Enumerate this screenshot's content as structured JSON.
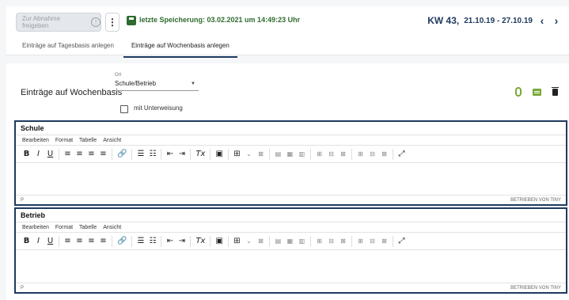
{
  "header": {
    "release_button": "Zur Abnahme freigeben",
    "release_info_icon": "!",
    "more_icon": "⋮",
    "save_status": "letzte Speicherung: 03.02.2021 um 14:49:23 Uhr",
    "week_label": "KW 43,",
    "week_range": "21.10.19 - 27.10.19",
    "prev_icon": "‹",
    "next_icon": "›"
  },
  "tabs": [
    {
      "label": "Einträge auf Tagesbasis anlegen",
      "active": false
    },
    {
      "label": "Einträge auf Wochenbasis anlegen",
      "active": true
    }
  ],
  "form": {
    "title": "Einträge auf Wochenbasis",
    "ort_label": "Ort",
    "ort_value": "Schule/Betrieb",
    "checkbox_label": "mit Unterweisung",
    "accent_color": "#7aa83a"
  },
  "editors": [
    {
      "title": "Schule",
      "menus": [
        "Bearbeiten",
        "Format",
        "Tabelle",
        "Ansicht"
      ],
      "path": "P",
      "powered": "BETRIEBEN VON TINY"
    },
    {
      "title": "Betrieb",
      "menus": [
        "Bearbeiten",
        "Format",
        "Tabelle",
        "Ansicht"
      ],
      "path": "P",
      "powered": "BETRIEBEN VON TINY"
    }
  ],
  "toolbar": {
    "bold": "B",
    "italic": "I",
    "underline": "U",
    "align_left": "≡",
    "align_center": "≡",
    "align_right": "≡",
    "justify": "≡",
    "link": "🔗",
    "bullets": "☰",
    "numbers": "☷",
    "outdent": "⇤",
    "indent": "⇥",
    "clear": "Tx",
    "image": "▣",
    "table": "⊞",
    "table_caret": "⌄",
    "table_delete": "⊠",
    "t1": "▤",
    "t2": "▦",
    "t3": "▥",
    "t4": "⊞",
    "t5": "⊟",
    "t6": "⊠",
    "t7": "⊞",
    "t8": "⊟",
    "t9": "⊠",
    "fullscreen": "⤢"
  },
  "colors": {
    "brand": "#1e3a5f",
    "save_green": "#2e6b2f"
  }
}
